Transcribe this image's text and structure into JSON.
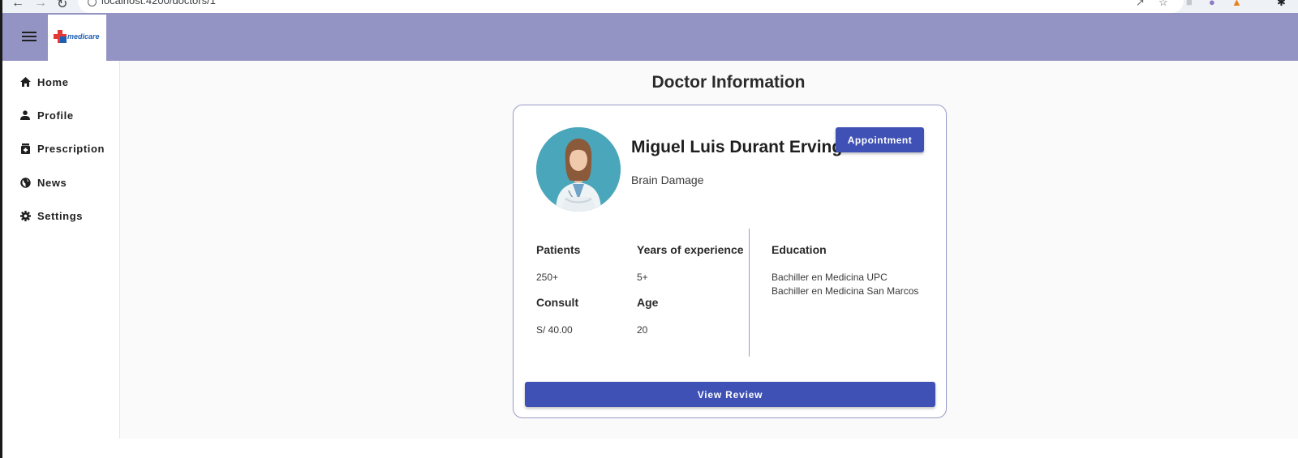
{
  "browser": {
    "url": "localhost:4200/doctors/1",
    "icons": [
      "back-arrow-icon",
      "forward-arrow-icon",
      "reload-icon",
      "site-info-icon",
      "share-icon",
      "bookmark-star-icon",
      "extensions-icon"
    ]
  },
  "toolbar": {
    "menu_icon": "hamburger-menu-icon",
    "logo_text": "medicare",
    "color": "#9494c4"
  },
  "sidebar": {
    "items": [
      {
        "label": "Home",
        "icon": "home-icon"
      },
      {
        "label": "Profile",
        "icon": "person-icon"
      },
      {
        "label": "Prescription",
        "icon": "medication-icon"
      },
      {
        "label": "News",
        "icon": "globe-icon"
      },
      {
        "label": "Settings",
        "icon": "gear-icon"
      }
    ]
  },
  "main": {
    "title": "Doctor Information",
    "doctor": {
      "name": "Miguel Luis Durant Erving",
      "specialty": "Brain Damage",
      "appointment_label": "Appointment",
      "stats": {
        "patients_label": "Patients",
        "patients_value": "250+",
        "experience_label": "Years of experience",
        "experience_value": "5+",
        "consult_label": "Consult",
        "consult_value": "S/ 40.00",
        "age_label": "Age",
        "age_value": "20"
      },
      "education_label": "Education",
      "education": [
        "Bachiller en Medicina UPC",
        "Bachiller en Medicina San Marcos"
      ],
      "review_label": "View Review"
    }
  },
  "colors": {
    "primary": "#3f51b5",
    "toolbar": "#9494c4",
    "card_border": "#9a9ac8",
    "background": "#fafafa"
  }
}
